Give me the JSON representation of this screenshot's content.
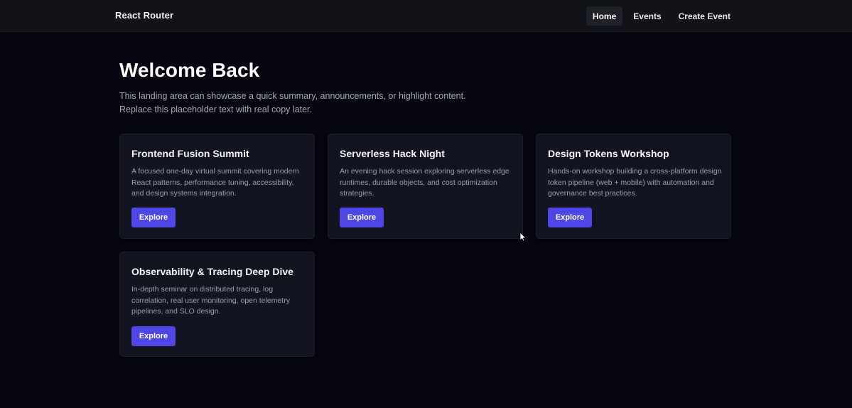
{
  "navbar": {
    "brand": "React Router",
    "items": [
      {
        "label": "Home",
        "active": true
      },
      {
        "label": "Events",
        "active": false
      },
      {
        "label": "Create Event",
        "active": false
      }
    ]
  },
  "main": {
    "title": "Welcome Back",
    "intro_lines": [
      "This landing area can showcase a quick summary, announcements, or highlight content.",
      "Replace this placeholder text with real copy later."
    ]
  },
  "events": [
    {
      "title": "Frontend Fusion Summit",
      "description": "A focused one-day virtual summit covering modern React patterns, performance tuning, accessibility, and design systems integration.",
      "button_label": "Explore"
    },
    {
      "title": "Serverless Hack Night",
      "description": "An evening hack session exploring serverless edge runtimes, durable objects, and cost optimization strategies.",
      "button_label": "Explore"
    },
    {
      "title": "Design Tokens Workshop",
      "description": "Hands-on workshop building a cross-platform design token pipeline (web + mobile) with automation and governance best practices.",
      "button_label": "Explore"
    },
    {
      "title": "Observability & Tracing Deep Dive",
      "description": "In-depth seminar on distributed tracing, log correlation, real user monitoring, open telemetry pipelines, and SLO design.",
      "button_label": "Explore"
    }
  ],
  "colors": {
    "background": "#05060f",
    "navbar": "#111319",
    "card": "#121520",
    "accent": "#4f46e5"
  },
  "icons": {
    "cursor": "mouse-pointer-icon"
  }
}
